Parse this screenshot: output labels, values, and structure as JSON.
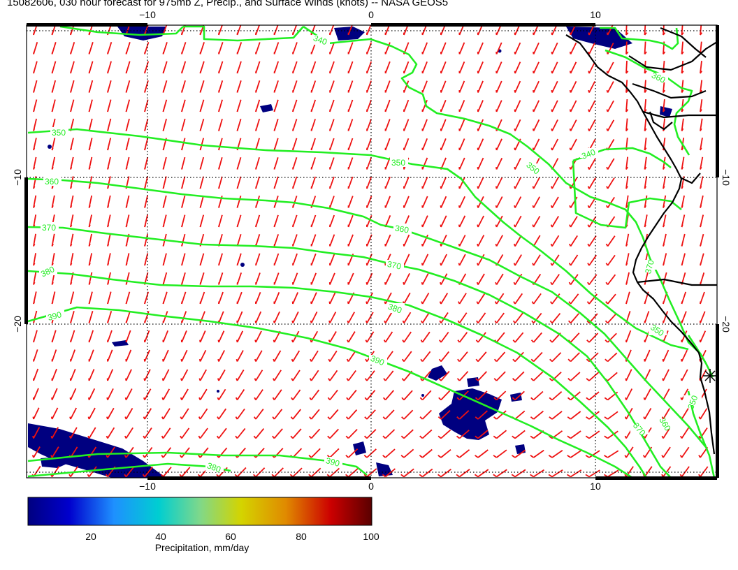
{
  "title": "15082606, 030 hour forecast for 975mb Z, Precip., and Surface Winds (knots) -- NASA GEOS5",
  "map": {
    "x_ticks": [
      "−10",
      "0",
      "10"
    ],
    "y_ticks": [
      "−10",
      "−20"
    ],
    "contour_labels": [
      "340",
      "350",
      "350",
      "360",
      "360",
      "370",
      "370",
      "380",
      "380",
      "390",
      "390",
      "390",
      "340",
      "350",
      "350",
      "360",
      "370",
      "380",
      "350",
      "360",
      "370"
    ],
    "colors": {
      "frame": "#000000",
      "wind_barb": "#ee1111",
      "contour": "#22ee22",
      "precip": "#000080",
      "coastline": "#000000"
    },
    "icons": [
      "wind-barb-icon",
      "station-star-icon"
    ]
  },
  "colorbar": {
    "ticks": [
      "20",
      "40",
      "60",
      "80",
      "100"
    ],
    "label": "Precipitation, mm/day",
    "stops": [
      "#000080",
      "#0000cd",
      "#1e90ff",
      "#00ced1",
      "#7fd88a",
      "#d4d400",
      "#e08a00",
      "#cc0000",
      "#5a0000"
    ]
  }
}
